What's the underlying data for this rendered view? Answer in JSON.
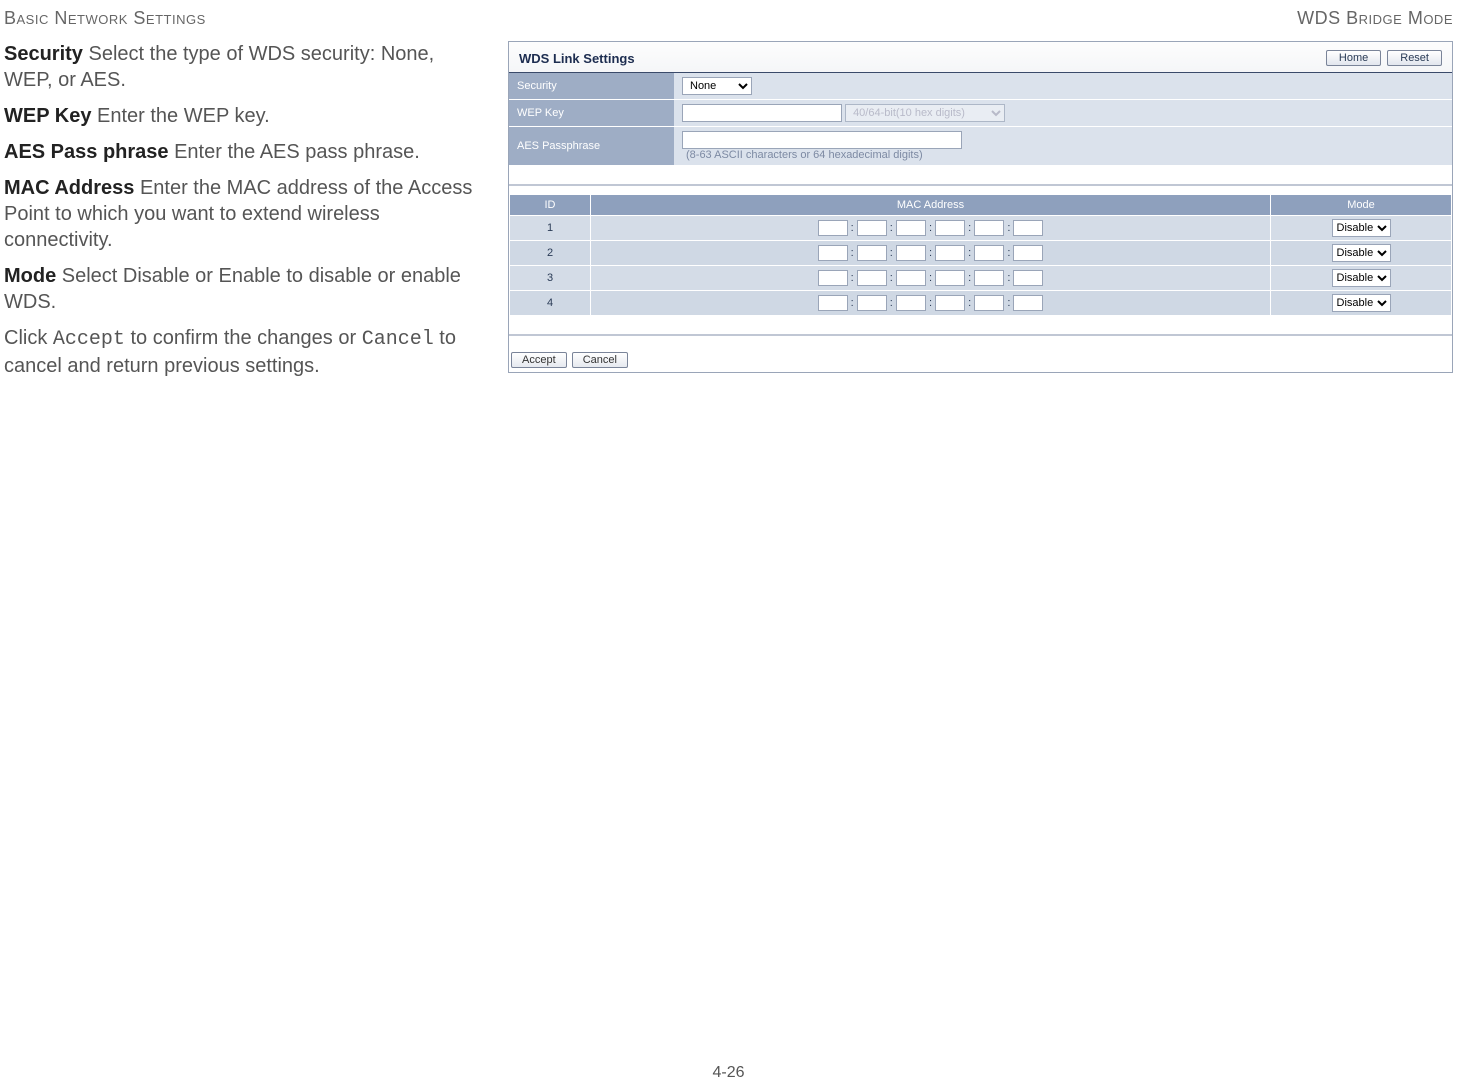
{
  "header": {
    "left": "Basic Network Settings",
    "right": "WDS Bridge Mode"
  },
  "doc": {
    "security_term": "Security",
    "security_desc": "  Select the type of WDS security: None, WEP, or AES.",
    "wepkey_term": "WEP Key",
    "wepkey_desc": "  Enter the WEP key.",
    "aes_term": "AES Pass phrase",
    "aes_desc": "  Enter the AES pass phrase.",
    "mac_term": "MAC Address",
    "mac_desc": "  Enter the MAC address of the Access Point to which you want to extend wireless connectivity.",
    "mode_term": "Mode",
    "mode_desc": "  Select Disable or Enable to disable or enable WDS.",
    "click_pre": "Click ",
    "accept_mono": "Accept",
    "click_mid": " to confirm the changes or ",
    "cancel_mono": "Cancel",
    "click_post": " to cancel and return previous settings."
  },
  "ui": {
    "title": "WDS Link Settings",
    "home": "Home",
    "reset": "Reset",
    "rows": {
      "security": "Security",
      "wepkey": "WEP Key",
      "aespass": "AES Passphrase"
    },
    "security_value": "None",
    "wep_mode": "40/64-bit(10 hex digits)",
    "aes_hint": "(8-63 ASCII characters or 64 hexadecimal digits)",
    "mac_headers": {
      "id": "ID",
      "mac": "MAC Address",
      "mode": "Mode"
    },
    "mac_rows": [
      {
        "id": "1",
        "mode": "Disable"
      },
      {
        "id": "2",
        "mode": "Disable"
      },
      {
        "id": "3",
        "mode": "Disable"
      },
      {
        "id": "4",
        "mode": "Disable"
      }
    ],
    "accept": "Accept",
    "cancel": "Cancel",
    "sep": ":"
  },
  "footer": "4-26"
}
